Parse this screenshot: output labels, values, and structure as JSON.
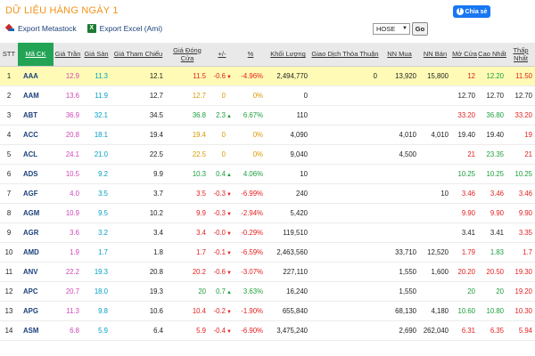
{
  "header": {
    "title": "DỮ LIỆU HÀNG NGÀY 1",
    "share_label": "Chia sẻ",
    "export_metastock": "Export Metastock",
    "export_excel": "Export Excel (Ami)",
    "exchange_selected": "HOSE",
    "go_label": "Go"
  },
  "colors": {
    "title": "#f29318",
    "ceiling": "#d046b8",
    "floor": "#00a0c6",
    "up": "#1b9e3a",
    "down": "#e32020",
    "ref": "#d99a00",
    "highlight": "#fffbb6",
    "mack_header": "#23a455"
  },
  "columns": {
    "stt": "STT",
    "symbol": "Mã CK",
    "ceiling": "Giá Trần",
    "floor": "Giá Sàn",
    "ref": "Giá Tham Chiếu",
    "close": "Giá Đóng Cửa",
    "change": "+/-",
    "pct": "%",
    "volume": "Khối Lượng",
    "deal": "Giao Dịch Thỏa Thuận",
    "nn_buy": "NN Mua",
    "nn_sell": "NN Bán",
    "open": "Mở Cửa",
    "high": "Cao Nhất",
    "low": "Thấp Nhất"
  },
  "rows": [
    {
      "stt": "1",
      "sym": "AAA",
      "ceil": "12.9",
      "floor": "11.3",
      "ref": "12.1",
      "close": "11.5",
      "chg": "-0.6",
      "pct": "-4.96%",
      "vol": "2,494,770",
      "deal": "0",
      "nnb": "13,920",
      "nns": "15,800",
      "open": "12",
      "high": "12.20",
      "low": "11.50",
      "dir": "down",
      "hl": true,
      "oc": "red",
      "hc": "green",
      "lc": "red"
    },
    {
      "stt": "2",
      "sym": "AAM",
      "ceil": "13.6",
      "floor": "11.9",
      "ref": "12.7",
      "close": "12.7",
      "chg": "0",
      "pct": "0%",
      "vol": "0",
      "deal": "",
      "nnb": "",
      "nns": "",
      "open": "12.70",
      "high": "12.70",
      "low": "12.70",
      "dir": "none",
      "hl": false,
      "oc": "",
      "hc": "",
      "lc": ""
    },
    {
      "stt": "3",
      "sym": "ABT",
      "ceil": "36.9",
      "floor": "32.1",
      "ref": "34.5",
      "close": "36.8",
      "chg": "2.3",
      "pct": "6.67%",
      "vol": "110",
      "deal": "",
      "nnb": "",
      "nns": "",
      "open": "33.20",
      "high": "36.80",
      "low": "33.20",
      "dir": "up",
      "hl": false,
      "oc": "red",
      "hc": "green",
      "lc": "red"
    },
    {
      "stt": "4",
      "sym": "ACC",
      "ceil": "20.8",
      "floor": "18.1",
      "ref": "19.4",
      "close": "19.4",
      "chg": "0",
      "pct": "0%",
      "vol": "4,090",
      "deal": "",
      "nnb": "4,010",
      "nns": "4,010",
      "open": "19.40",
      "high": "19.40",
      "low": "19",
      "dir": "none",
      "hl": false,
      "oc": "",
      "hc": "",
      "lc": "red"
    },
    {
      "stt": "5",
      "sym": "ACL",
      "ceil": "24.1",
      "floor": "21.0",
      "ref": "22.5",
      "close": "22.5",
      "chg": "0",
      "pct": "0%",
      "vol": "9,040",
      "deal": "",
      "nnb": "4,500",
      "nns": "",
      "open": "21",
      "high": "23.35",
      "low": "21",
      "dir": "none",
      "hl": false,
      "oc": "red",
      "hc": "green",
      "lc": "red"
    },
    {
      "stt": "6",
      "sym": "ADS",
      "ceil": "10.5",
      "floor": "9.2",
      "ref": "9.9",
      "close": "10.3",
      "chg": "0.4",
      "pct": "4.06%",
      "vol": "10",
      "deal": "",
      "nnb": "",
      "nns": "",
      "open": "10.25",
      "high": "10.25",
      "low": "10.25",
      "dir": "up",
      "hl": false,
      "oc": "green",
      "hc": "green",
      "lc": "green"
    },
    {
      "stt": "7",
      "sym": "AGF",
      "ceil": "4.0",
      "floor": "3.5",
      "ref": "3.7",
      "close": "3.5",
      "chg": "-0.3",
      "pct": "-6.99%",
      "vol": "240",
      "deal": "",
      "nnb": "",
      "nns": "10",
      "open": "3.46",
      "high": "3.46",
      "low": "3.46",
      "dir": "down",
      "hl": false,
      "oc": "red",
      "hc": "red",
      "lc": "red"
    },
    {
      "stt": "8",
      "sym": "AGM",
      "ceil": "10.9",
      "floor": "9.5",
      "ref": "10.2",
      "close": "9.9",
      "chg": "-0.3",
      "pct": "-2.94%",
      "vol": "5,420",
      "deal": "",
      "nnb": "",
      "nns": "",
      "open": "9.90",
      "high": "9.90",
      "low": "9.90",
      "dir": "down",
      "hl": false,
      "oc": "red",
      "hc": "red",
      "lc": "red"
    },
    {
      "stt": "9",
      "sym": "AGR",
      "ceil": "3.6",
      "floor": "3.2",
      "ref": "3.4",
      "close": "3.4",
      "chg": "-0.0",
      "pct": "-0.29%",
      "vol": "119,510",
      "deal": "",
      "nnb": "",
      "nns": "",
      "open": "3.41",
      "high": "3.41",
      "low": "3.35",
      "dir": "down",
      "hl": false,
      "oc": "",
      "hc": "",
      "lc": "red"
    },
    {
      "stt": "10",
      "sym": "AMD",
      "ceil": "1.9",
      "floor": "1.7",
      "ref": "1.8",
      "close": "1.7",
      "chg": "-0.1",
      "pct": "-6.59%",
      "vol": "2,463,560",
      "deal": "",
      "nnb": "33,710",
      "nns": "12,520",
      "open": "1.79",
      "high": "1.83",
      "low": "1.7",
      "dir": "down",
      "hl": false,
      "oc": "red",
      "hc": "green",
      "lc": "red"
    },
    {
      "stt": "11",
      "sym": "ANV",
      "ceil": "22.2",
      "floor": "19.3",
      "ref": "20.8",
      "close": "20.2",
      "chg": "-0.6",
      "pct": "-3.07%",
      "vol": "227,110",
      "deal": "",
      "nnb": "1,550",
      "nns": "1,600",
      "open": "20.20",
      "high": "20.50",
      "low": "19.30",
      "dir": "down",
      "hl": false,
      "oc": "red",
      "hc": "red",
      "lc": "red"
    },
    {
      "stt": "12",
      "sym": "APC",
      "ceil": "20.7",
      "floor": "18.0",
      "ref": "19.3",
      "close": "20",
      "chg": "0.7",
      "pct": "3.63%",
      "vol": "16,240",
      "deal": "",
      "nnb": "1,550",
      "nns": "",
      "open": "20",
      "high": "20",
      "low": "19.20",
      "dir": "up",
      "hl": false,
      "oc": "green",
      "hc": "green",
      "lc": "red"
    },
    {
      "stt": "13",
      "sym": "APG",
      "ceil": "11.3",
      "floor": "9.8",
      "ref": "10.6",
      "close": "10.4",
      "chg": "-0.2",
      "pct": "-1.90%",
      "vol": "655,840",
      "deal": "",
      "nnb": "68,130",
      "nns": "4,180",
      "open": "10.60",
      "high": "10.80",
      "low": "10.30",
      "dir": "down",
      "hl": false,
      "oc": "green",
      "hc": "green",
      "lc": "red"
    },
    {
      "stt": "14",
      "sym": "ASM",
      "ceil": "6.8",
      "floor": "5.9",
      "ref": "6.4",
      "close": "5.9",
      "chg": "-0.4",
      "pct": "-6.90%",
      "vol": "3,475,240",
      "deal": "",
      "nnb": "2,690",
      "nns": "262,040",
      "open": "6.31",
      "high": "6.35",
      "low": "5.94",
      "dir": "down",
      "hl": false,
      "oc": "red",
      "hc": "red",
      "lc": "red"
    }
  ]
}
